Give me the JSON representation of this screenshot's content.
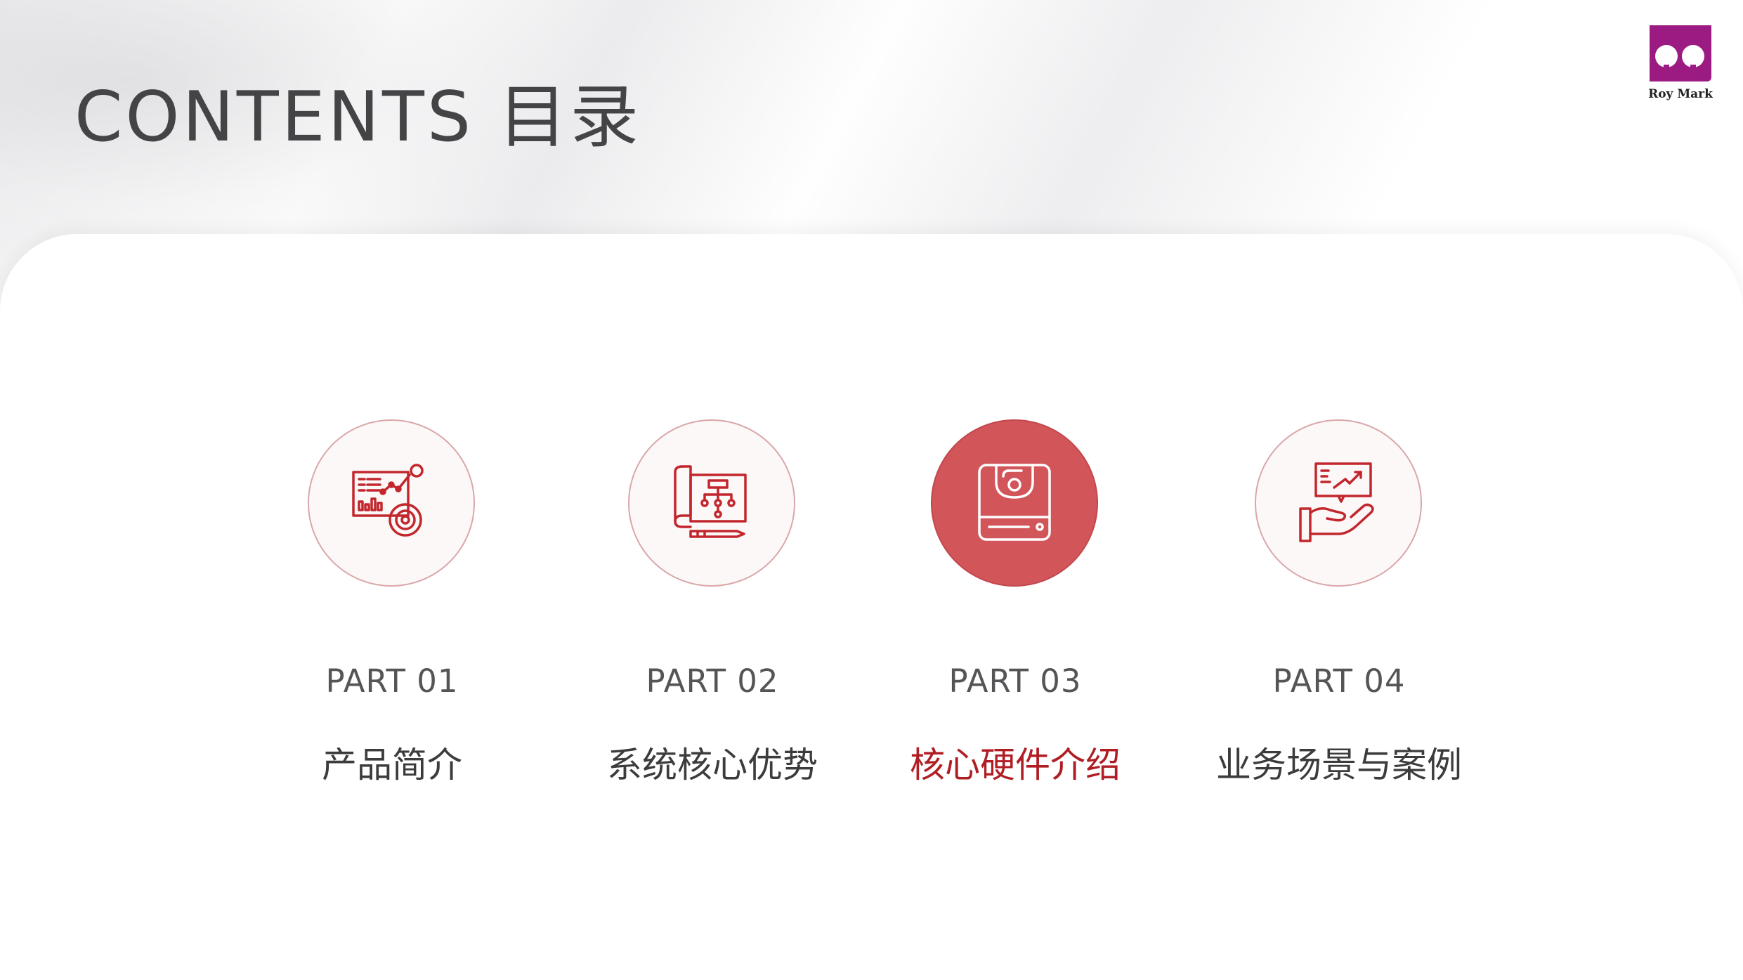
{
  "header": {
    "title": "CONTENTS  目录",
    "logo_text": "Roy Mark"
  },
  "colors": {
    "accent": "#b01e24",
    "accent_circle": "#d2555a",
    "logo": "#9b1b83",
    "text": "#444446"
  },
  "items": [
    {
      "part": "PART 01",
      "label": "产品简介",
      "icon": "analytics-chart-icon",
      "active": false
    },
    {
      "part": "PART 02",
      "label": "系统核心优势",
      "icon": "blueprint-flowchart-icon",
      "active": false
    },
    {
      "part": "PART 03",
      "label": "核心硬件介绍",
      "icon": "hardware-device-icon",
      "active": true
    },
    {
      "part": "PART 04",
      "label": "业务场景与案例",
      "icon": "hand-presentation-icon",
      "active": false
    }
  ]
}
